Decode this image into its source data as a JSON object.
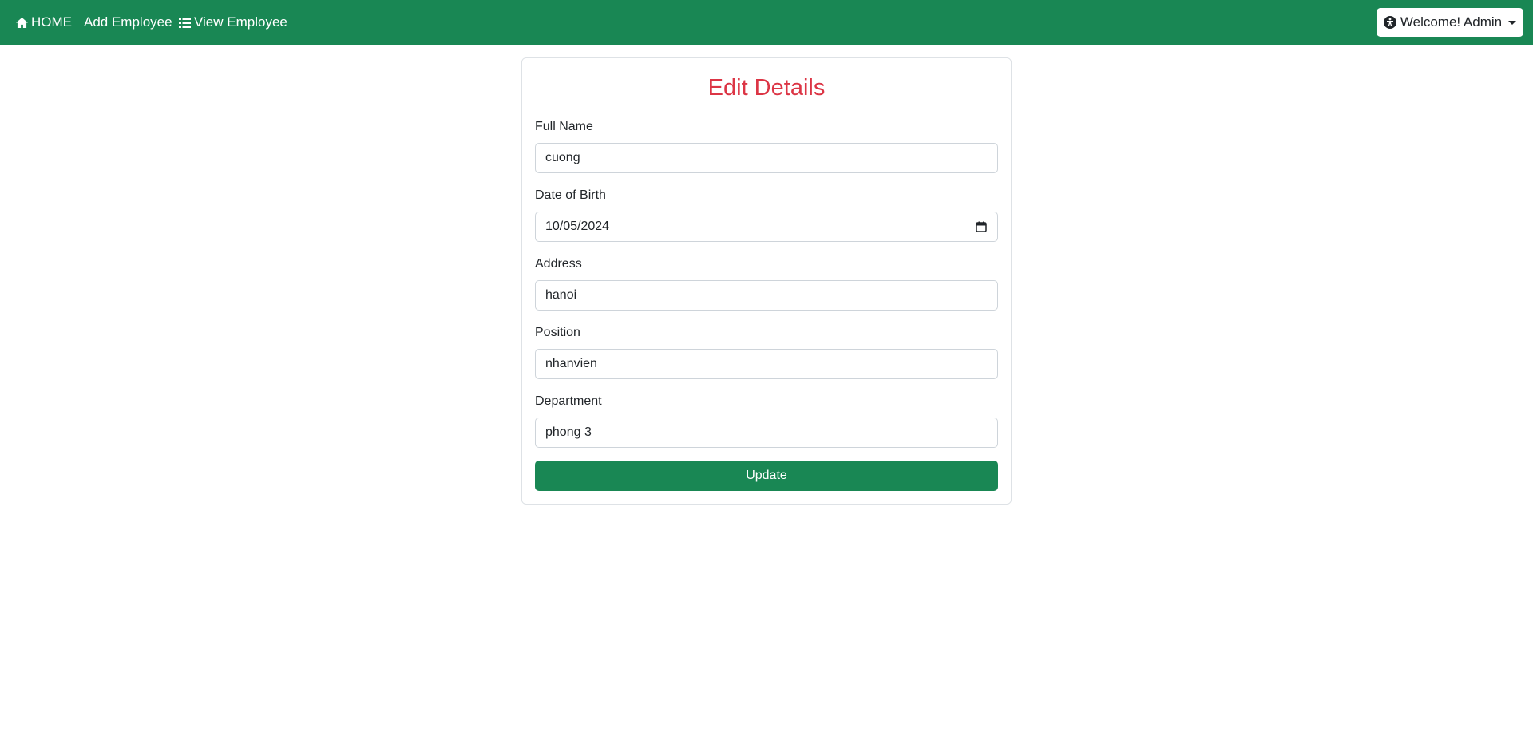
{
  "navbar": {
    "bg_color": "#198754",
    "home_label": "HOME",
    "add_label": "Add Employee",
    "view_label": "View Employee",
    "user_menu_label": "Welcome! Admin",
    "icons": [
      "home-icon",
      "list-icon",
      "accessibility-icon",
      "caret-down-icon"
    ]
  },
  "form": {
    "title": "Edit Details",
    "title_color": "#dc3545",
    "fields": [
      {
        "label": "Full Name",
        "value": "cuong"
      },
      {
        "label": "Date of Birth",
        "value": "10/05/2024"
      },
      {
        "label": "Address",
        "value": "hanoi"
      },
      {
        "label": "Position",
        "value": "nhanvien"
      },
      {
        "label": "Department",
        "value": "phong 3"
      }
    ],
    "submit_label": "Update"
  }
}
